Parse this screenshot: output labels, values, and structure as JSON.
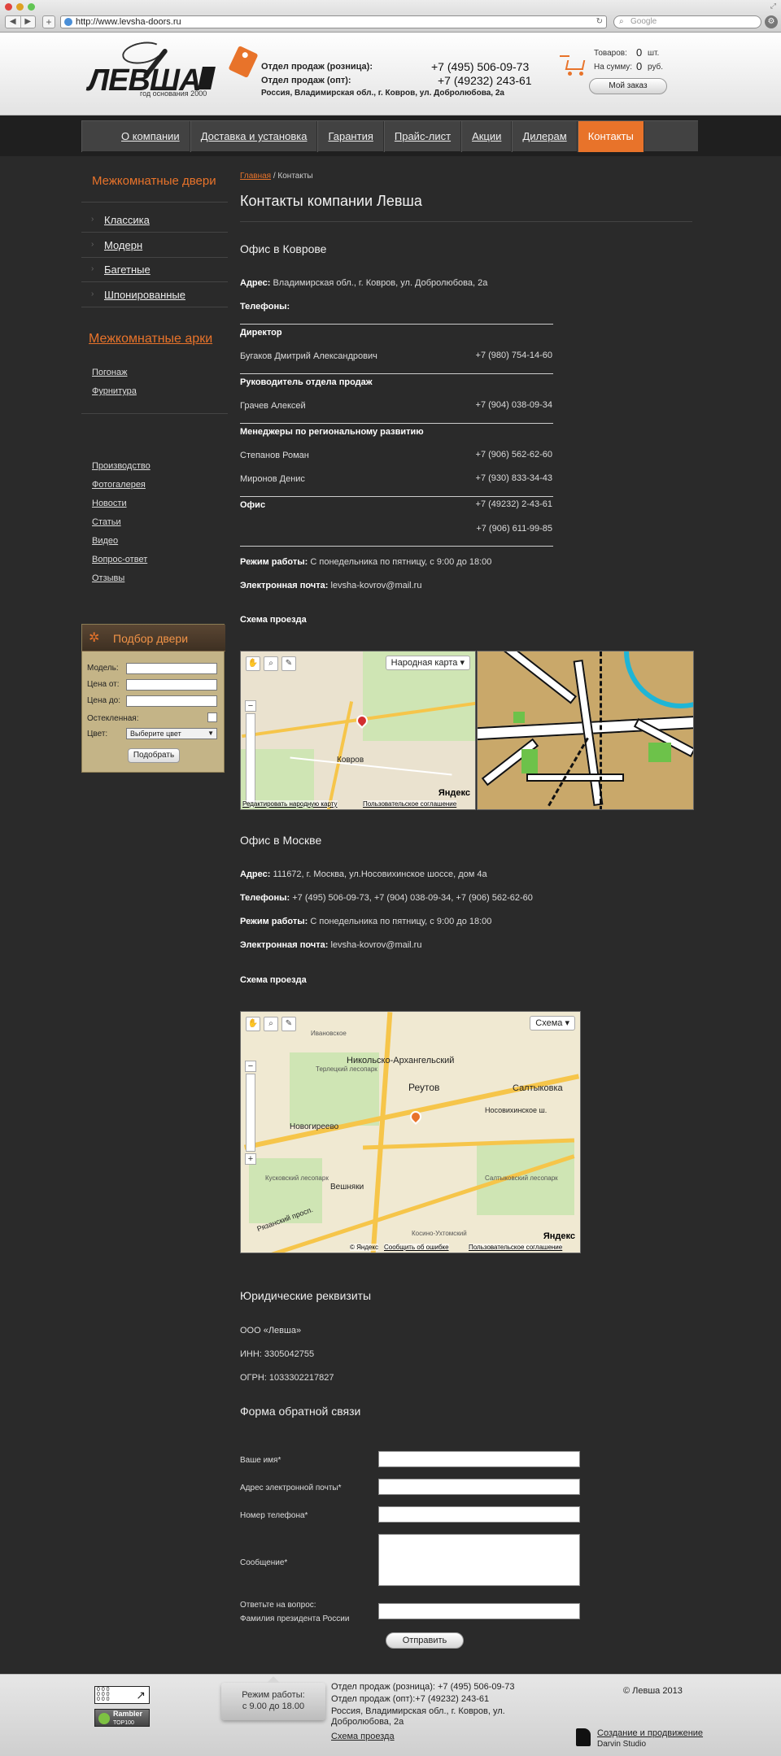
{
  "browser": {
    "url": "http://www.levsha-doors.ru",
    "search_placeholder": "Google",
    "back": "◀",
    "forward": "▶",
    "add": "+"
  },
  "header": {
    "logo_text": "ЛЕВША",
    "logo_sub": "год основания 2000",
    "sales_retail_label": "Отдел продаж (розница):",
    "sales_wholesale_label": "Отдел продаж (опт):",
    "address": "Россия, Владимирская обл., г. Ковров, ул. Добролюбова, 2а",
    "phone_retail": "+7 (495) 506-09-73",
    "phone_wholesale": "+7 (49232) 243-61",
    "cart": {
      "items_label": "Товаров:",
      "items_value": "0",
      "items_unit": "шт.",
      "sum_label": "На сумму:",
      "sum_value": "0",
      "sum_unit": "руб.",
      "order_button": "Мой заказ"
    }
  },
  "nav": {
    "items": [
      {
        "label": "О компании",
        "active": false
      },
      {
        "label": "Доставка и установка",
        "active": false
      },
      {
        "label": "Гарантия",
        "active": false
      },
      {
        "label": "Прайс-лист",
        "active": false
      },
      {
        "label": "Акции",
        "active": false
      },
      {
        "label": "Дилерам",
        "active": false
      },
      {
        "label": "Контакты",
        "active": true
      }
    ]
  },
  "sidebar": {
    "doors_title": "Межкомнатные двери",
    "doors_items": [
      "Классика",
      "Модерн",
      "Багетные",
      "Шпонированные"
    ],
    "arches_title": "Межкомнатные арки",
    "arches_items": [
      "Погонаж",
      "Фурнитура"
    ],
    "info_links": [
      "Производство",
      "Фотогалерея",
      "Новости",
      "Статьи",
      "Видео",
      "Вопрос-ответ",
      "Отзывы"
    ],
    "filter": {
      "title": "Подбор двери",
      "model_label": "Модель:",
      "price_from_label": "Цена от:",
      "price_to_label": "Цена до:",
      "glazing_label": "Остекленная:",
      "color_label": "Цвет:",
      "color_value": "Выберите цвет",
      "submit": "Подобрать"
    }
  },
  "main": {
    "breadcrumb_home": "Главная",
    "breadcrumb_sep": "/",
    "breadcrumb_current": "Контакты",
    "title": "Контакты компании Левша",
    "kovrov": {
      "title": "Офис в Коврове",
      "address_label": "Адрес:",
      "address": "Владимирская обл., г. Ковров, ул. Добролюбова, 2а",
      "phones_label": "Телефоны:",
      "director_title": "Директор",
      "director_name": "Бугаков Дмитрий Александрович",
      "director_phone": "+7 (980) 754-14-60",
      "sales_head_title": "Руководитель отдела продаж",
      "sales_head_name": "Грачев Алексей",
      "sales_head_phone": "+7 (904) 038-09-34",
      "managers_title": "Менеджеры по региональному развитию",
      "manager1_name": "Степанов Роман",
      "manager1_phone": "+7 (906) 562-62-60",
      "manager2_name": "Миронов Денис",
      "manager2_phone": "+7 (930) 833-34-43",
      "office_title": "Офис",
      "office_phone1": "+7 (49232) 2-43-61",
      "office_phone2": "+7 (906) 611-99-85",
      "hours_label": "Режим работы:",
      "hours": "С понедельника по пятницу, с 9:00 до 18:00",
      "email_label": "Электронная почта:",
      "email": "levsha-kovrov@mail.ru",
      "scheme_title": "Схема проезда",
      "map_type": "Народная карта",
      "map_city": "Ковров",
      "map_logo": "Яндекс",
      "map_edit_link": "Редактировать народную карту",
      "map_terms_link": "Пользовательское соглашение"
    },
    "moscow": {
      "title": "Офис в Москве",
      "address_label": "Адрес:",
      "address": "111672, г. Москва, ул.Носовихинское шоссе, дом 4а",
      "phones_label": "Телефоны:",
      "phones": "+7 (495) 506-09-73, +7 (904) 038-09-34, +7 (906) 562-62-60",
      "hours_label": "Режим работы:",
      "hours": "С понедельника по пятницу, с 9:00 до 18:00",
      "email_label": "Электронная почта:",
      "email": "levsha-kovrov@mail.ru",
      "scheme_title": "Схема проезда",
      "map_type": "Схема",
      "map_labels": [
        "Никольско-Архангельский",
        "Реутов",
        "Салтыковка",
        "Новогиреево",
        "Вешняки",
        "Носовихинское ш.",
        "Терлецкий лесопарк",
        "Кусковский лесопарк",
        "Салтыковский лесопарк",
        "Косино-Ухтомский",
        "Ивановское",
        "Рязанский просп."
      ],
      "map_logo": "Яндекс",
      "map_copyright": "© Яндекс",
      "map_error_link": "Сообщить об ошибке",
      "map_terms_link": "Пользовательское соглашение"
    },
    "legal": {
      "title": "Юридические реквизиты",
      "company": "ООО «Левша»",
      "inn": "ИНН: 3305042755",
      "ogrn": "ОГРН: 1033302217827"
    },
    "feedback": {
      "title": "Форма обратной связи",
      "name_label": "Ваше имя*",
      "email_label": "Адрес электронной почты*",
      "phone_label": "Номер телефона*",
      "message_label": "Сообщение*",
      "question_label": "Ответьте на вопрос:",
      "question": "Фамилия президента России",
      "submit": "Отправить"
    }
  },
  "footer": {
    "counter_text": "0 0 0\n0 0 0\n0 0 0",
    "rambler_text": "Rambler",
    "rambler_sub": "TOP100",
    "work_hours_title": "Режим работы:",
    "work_hours": "с 9.00 до 18.00",
    "sales_retail": "Отдел продаж (розница): +7 (495) 506-09-73",
    "sales_wholesale": "Отдел продаж (опт):+7 (49232) 243-61",
    "address_line1": "Россия, Владимирская обл., г. Ковров, ул.",
    "address_line2": "Добролюбова, 2а",
    "scheme_link": "Схема проезда",
    "copyright": "© Левша 2013",
    "dev_link": "Создание и продвижение",
    "dev_name": "Darvin Studio"
  }
}
